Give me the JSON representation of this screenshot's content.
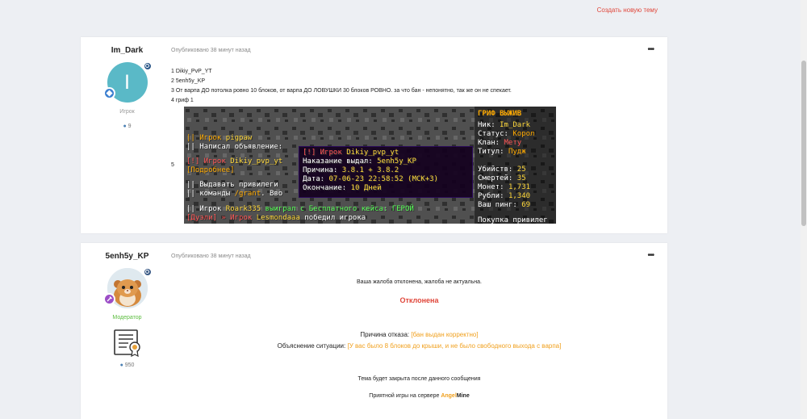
{
  "header": {
    "create_topic": "Создать новую тему"
  },
  "post1": {
    "author": "Im_Dark",
    "avatar_letter": "I",
    "role": "Игрок",
    "posts": "9",
    "published": "Опубликовано 38 минут назад",
    "more": "•••",
    "lines": [
      "1 Dikiy_PvP_YT",
      "2 5enh5y_KP",
      "3 От варпа ДО потолка ровно 10 блоков, от варпа ДО ЛОВУШКИ 30 блоков РОВНО. за что бан - непонятно, так же он не спекает.",
      "4 гриф 1"
    ],
    "line5": "5",
    "screenshot": {
      "chat": [
        {
          "prefix": "|| Игрок ",
          "hl": "Игрок:",
          "rest": " pigpaw"
        },
        {
          "prefix": "|| Написал объявление:",
          "hl": "",
          "rest": ""
        },
        {
          "prefix": "[!] Игрок ",
          "hl": "Dikiy_pvp_yt",
          "rest": ""
        },
        {
          "prefix": "[Подробнее]",
          "hl": "",
          "rest": ""
        },
        {
          "prefix": "|| Выдавать привилеги",
          "hl": "",
          "rest": ""
        },
        {
          "prefix": "|| команды ",
          "hl": "/grant",
          "rest": ". Вво"
        },
        {
          "prefix": "|| Игрок ",
          "hl": "Roark335",
          "rest": " выиграл с Бесплатного кейса: ГЕРОЙ"
        },
        {
          "prefix": "[Дуэли] » Игрок ",
          "hl": "Lesmondaaa",
          "rest": " победил игрока"
        }
      ],
      "tooltip": [
        {
          "label": "[!] Игрок ",
          "value": "Dikiy_pvp_yt"
        },
        {
          "label": "Наказание выдал: ",
          "value": "5enh5y_KP"
        },
        {
          "label": "Причина: ",
          "value": "3.8.1 + 3.8.2"
        },
        {
          "label": "Дата: ",
          "value": "07-06-23 22:58:52 (МСК+3)"
        },
        {
          "label": "Окончание: ",
          "value": "10 Дней"
        }
      ],
      "scoreboard_title": "ГРИФ ВЫЖИВ",
      "scoreboard": [
        {
          "label": "Ник: ",
          "value": "Im_Dark"
        },
        {
          "label": "Статус: ",
          "value": "Корол"
        },
        {
          "label": "Клан: ",
          "value": "Мету"
        },
        {
          "label": "Титул: ",
          "value": "Пудж"
        },
        {
          "label": "",
          "value": ""
        },
        {
          "label": "Убийств: ",
          "value": "25"
        },
        {
          "label": "Смертей: ",
          "value": "35"
        },
        {
          "label": "Монет: ",
          "value": "1,731"
        },
        {
          "label": "Рубли: ",
          "value": "1,340"
        },
        {
          "label": "Ваш пинг: ",
          "value": "69"
        },
        {
          "label": "",
          "value": ""
        },
        {
          "label": "Покупка привилег",
          "value": ""
        }
      ]
    }
  },
  "post2": {
    "author": "5enh5y_KP",
    "role": "Модератор",
    "posts": "950",
    "published": "Опубликовано 38 минут назад",
    "more": "•••",
    "message": "Ваша жалоба отклонена, жалоба не актуальна.",
    "status": "Отклонена",
    "reason_label": "Причина отказа:",
    "reason_value": "[бан выдан корректно]",
    "explain_label": "Объяснение ситуации:",
    "explain_value": "[У вас было 8 блоков до крыши, и не было свободного выхода с варпа]",
    "closing": "Тема будет закрыта после данного сообщения",
    "footer_prefix": "Приятной игры на сервере ",
    "brand_a": "Angel",
    "brand_b": "Mine"
  },
  "colors": {
    "accent": "#e0473b",
    "orange": "#f0a01e",
    "moderator": "#5cbd3f"
  }
}
